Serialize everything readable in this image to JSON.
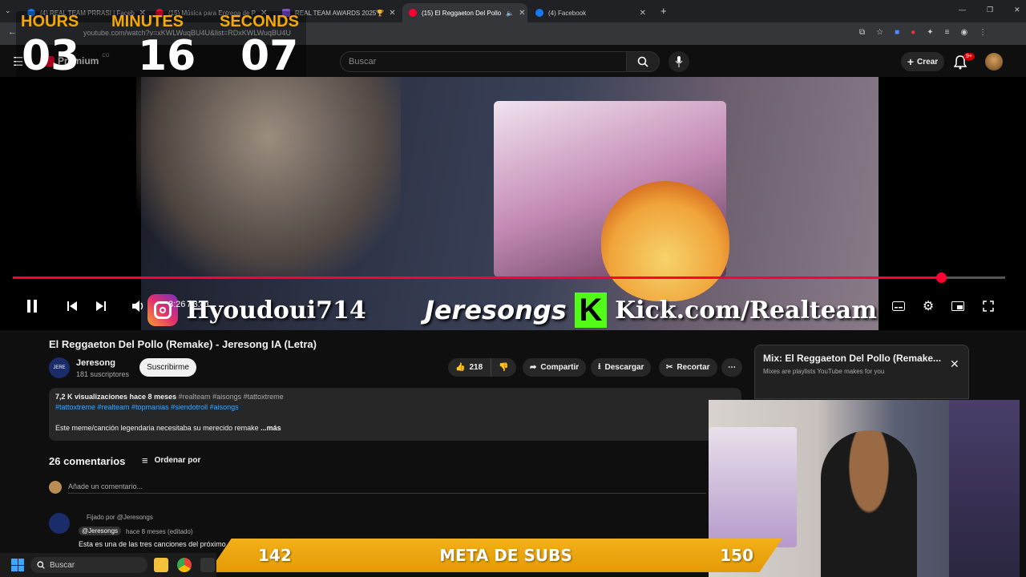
{
  "browser": {
    "tabs": [
      {
        "label": "(4) REAL TEAM PRRASI | Faceb",
        "color": "#1877f2"
      },
      {
        "label": "(15) Música para Entrega de P",
        "color": "#ff0033"
      },
      {
        "label": "REAL TEAM AWARDS 2025🏆",
        "color": "#7a4ce0"
      },
      {
        "label": "(15) El Reggaeton Del Pollo",
        "color": "#ff0033"
      },
      {
        "label": "(4) Facebook",
        "color": "#1877f2"
      }
    ],
    "url": "youtube.com/watch?v=xKWLWuqBU4U&list=RDxKWLWuqBU4U"
  },
  "timer": {
    "labels": [
      "HOURS",
      "MINUTES",
      "SECONDS"
    ],
    "values": [
      "03",
      "16",
      "07"
    ]
  },
  "header": {
    "logo_text": "Premium",
    "country": "CO",
    "search_placeholder": "Buscar",
    "create_label": "Crear",
    "notif_count": "9+"
  },
  "player": {
    "time": "3:26 / 3:41",
    "progress": 0.935,
    "banner_insta": "Hyoudoui714",
    "banner_name": "Jeresongs",
    "banner_kick": "Kick.com/Realteam",
    "kick_letter": "K"
  },
  "video": {
    "title": "El Reggaeton Del Pollo (Remake) - Jeresong IA (Letra)",
    "channel": "Jeresong",
    "subs": "181 suscriptores",
    "subscribe_label": "Suscribirme",
    "likes": "218",
    "share_label": "Compartir",
    "download_label": "Descargar",
    "clip_label": "Recortar",
    "views_line": "7,2 K visualizaciones  hace 8 meses",
    "tags_inline": "#realteam #aisongs #tattoxtreme",
    "tags_line": "#tattoxtreme #realteam #topmanias #siendotroll #aisongs",
    "desc_text": "Este meme/canción legendaria necesitaba su merecido remake",
    "more_label": "...más"
  },
  "comments": {
    "count_label": "26 comentarios",
    "sort_label": "Ordenar por",
    "add_placeholder": "Añade un comentario...",
    "pinned_label": "Fijado por @Jeresongs",
    "author": "@Jeresongs",
    "time": "hace 8 meses (editado)",
    "text": "Esta es una de las tres canciones del próximo ál"
  },
  "mix": {
    "title": "Mix: El Reggaeton Del Pollo (Remake...",
    "subtitle": "Mixes are playlists YouTube makes for you"
  },
  "subsgoal": {
    "current": "142",
    "label": "META DE SUBS",
    "goal": "150"
  },
  "taskbar": {
    "search_label": "Buscar"
  }
}
